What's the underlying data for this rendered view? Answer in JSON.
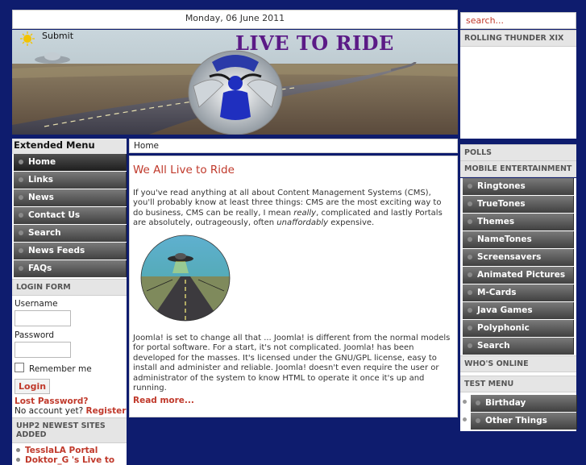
{
  "header": {
    "date": "Monday, 06 June 2011",
    "search_placeholder": "search..."
  },
  "banner": {
    "submit_label": "Submit",
    "title": "LIVE TO RIDE",
    "logo_text": "LIVE TO RIDE"
  },
  "left": {
    "menu_title": "Extended Menu",
    "menu_items": [
      "Home",
      "Links",
      "News",
      "Contact Us",
      "Search",
      "News Feeds",
      "FAQs"
    ],
    "login_title": "LOGIN FORM",
    "username_label": "Username",
    "password_label": "Password",
    "remember_label": "Remember me",
    "login_button": "Login",
    "lost_password": "Lost Password?",
    "no_account": "No account yet?",
    "register": "Register",
    "newest_title": "UHP2 NEWEST SITES ADDED",
    "newest_items": [
      "TesslaLA Portal",
      "Doktor_G 's Live to"
    ]
  },
  "main": {
    "breadcrumb": "Home",
    "title": "We All Live to Ride",
    "para1": {
      "part1": "If you've read anything at all about Content Management Systems (CMS), you'll probably know at least three things: CMS are the most exciting way to do business, CMS can be really, I mean ",
      "em1": "really",
      "part2": ", complicated and lastly Portals are absolutely, outrageously, often ",
      "em2": "unaffordably",
      "part3": " expensive."
    },
    "para2": "Joomla! is set to change all that ... Joomla! is different from the normal models for portal software. For a start, it's not complicated. Joomla! has been developed for the masses. It's licensed under the GNU/GPL license, easy to install and administer and reliable. Joomla! doesn't even require the user or administrator of the system to know HTML to operate it once it's up and running.",
    "read_more": "Read more..."
  },
  "right": {
    "rolling_title": "ROLLING THUNDER XIX",
    "polls_title": "POLLS",
    "mobile_title": "MOBILE ENTERTAINMENT",
    "mobile_items": [
      "Ringtones",
      "TrueTones",
      "Themes",
      "NameTones",
      "Screensavers",
      "Animated Pictures",
      "M-Cards",
      "Java Games",
      "Polyphonic",
      "Search"
    ],
    "online_title": "WHO'S ONLINE",
    "test_title": "TEST MENU",
    "test_items": [
      "Birthday",
      "Other Things"
    ]
  },
  "colors": {
    "background": "#0e1c6e",
    "link_red": "#c0392b",
    "banner_title": "#5b1a86"
  }
}
